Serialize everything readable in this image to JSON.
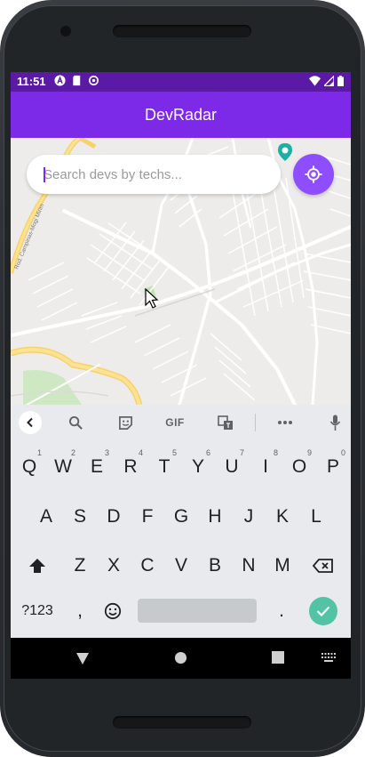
{
  "status": {
    "time": "11:51",
    "left_icons": [
      "a-badge-icon",
      "sd-card-icon",
      "sync-icon"
    ],
    "right_icons": [
      "wifi-icon",
      "signal-icon",
      "battery-icon"
    ]
  },
  "app": {
    "title": "DevRadar"
  },
  "search": {
    "placeholder": "Search devs by techs...",
    "value": ""
  },
  "map": {
    "road_labels": [
      "Rod. Campinas-Mogi Mirim"
    ],
    "marker_icon": "map-pin-icon"
  },
  "locate_button": {
    "icon": "my-location-icon"
  },
  "keyboard": {
    "toolbar": [
      "back-icon",
      "search-icon",
      "sticker-icon",
      "GIF",
      "translate-icon",
      "more-icon",
      "mic-icon"
    ],
    "rows": [
      [
        {
          "label": "Q",
          "hint": "1"
        },
        {
          "label": "W",
          "hint": "2"
        },
        {
          "label": "E",
          "hint": "3"
        },
        {
          "label": "R",
          "hint": "4"
        },
        {
          "label": "T",
          "hint": "5"
        },
        {
          "label": "Y",
          "hint": "6"
        },
        {
          "label": "U",
          "hint": "7"
        },
        {
          "label": "I",
          "hint": "8"
        },
        {
          "label": "O",
          "hint": "9"
        },
        {
          "label": "P",
          "hint": "0"
        }
      ],
      [
        {
          "label": "A"
        },
        {
          "label": "S"
        },
        {
          "label": "D"
        },
        {
          "label": "F"
        },
        {
          "label": "G"
        },
        {
          "label": "H"
        },
        {
          "label": "J"
        },
        {
          "label": "K"
        },
        {
          "label": "L"
        }
      ],
      [
        {
          "label": "Z"
        },
        {
          "label": "X"
        },
        {
          "label": "C"
        },
        {
          "label": "V"
        },
        {
          "label": "B"
        },
        {
          "label": "N"
        },
        {
          "label": "M"
        }
      ]
    ],
    "symbols_key": "?123",
    "comma_key": ",",
    "period_key": ".",
    "accent": "#52c3a5"
  },
  "colors": {
    "app_bar": "#7d2ae8",
    "status_bar": "#5a1aa6",
    "locate_button": "#8e4dff"
  }
}
